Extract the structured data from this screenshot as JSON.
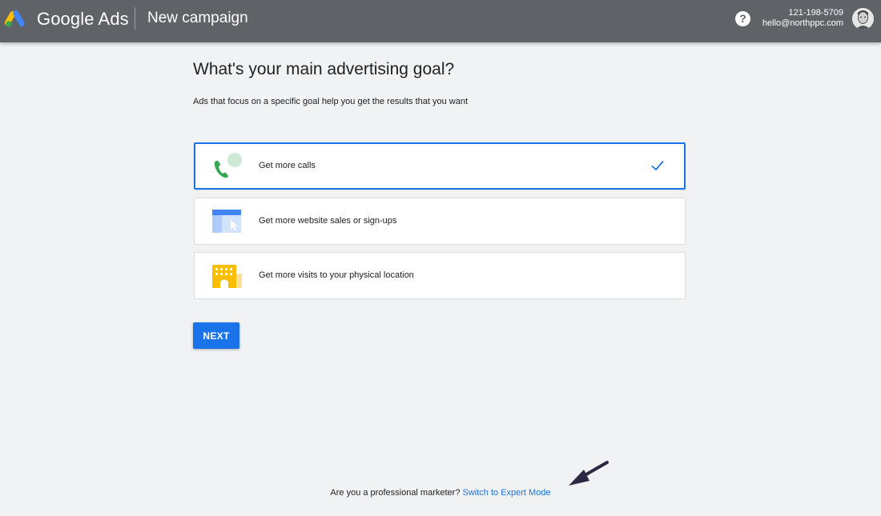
{
  "app": {
    "brand": "Google Ads",
    "page_title": "New campaign"
  },
  "account": {
    "phone": "121-198-5709",
    "email": "hello@northppc.com"
  },
  "icons": {
    "logo": "google-ads-logo",
    "help": "help-circle-icon",
    "avatar": "user-avatar"
  },
  "main": {
    "heading": "What's your main advertising goal?",
    "subheading": "Ads that focus on a specific goal help you get the results that you want",
    "goals": [
      {
        "label": "Get more calls",
        "icon": "phone-call-icon",
        "selected": true
      },
      {
        "label": "Get more website sales or sign-ups",
        "icon": "website-cursor-icon",
        "selected": false
      },
      {
        "label": "Get more visits to your physical location",
        "icon": "store-building-icon",
        "selected": false
      }
    ],
    "next_label": "NEXT"
  },
  "footer": {
    "question": "Are you a professional marketer?",
    "link": "Switch to Expert Mode"
  },
  "colors": {
    "topbar": "#5f6368",
    "accent": "#1a73e8",
    "background": "#f1f2f4",
    "annotation_arrow": "#2e2743"
  }
}
